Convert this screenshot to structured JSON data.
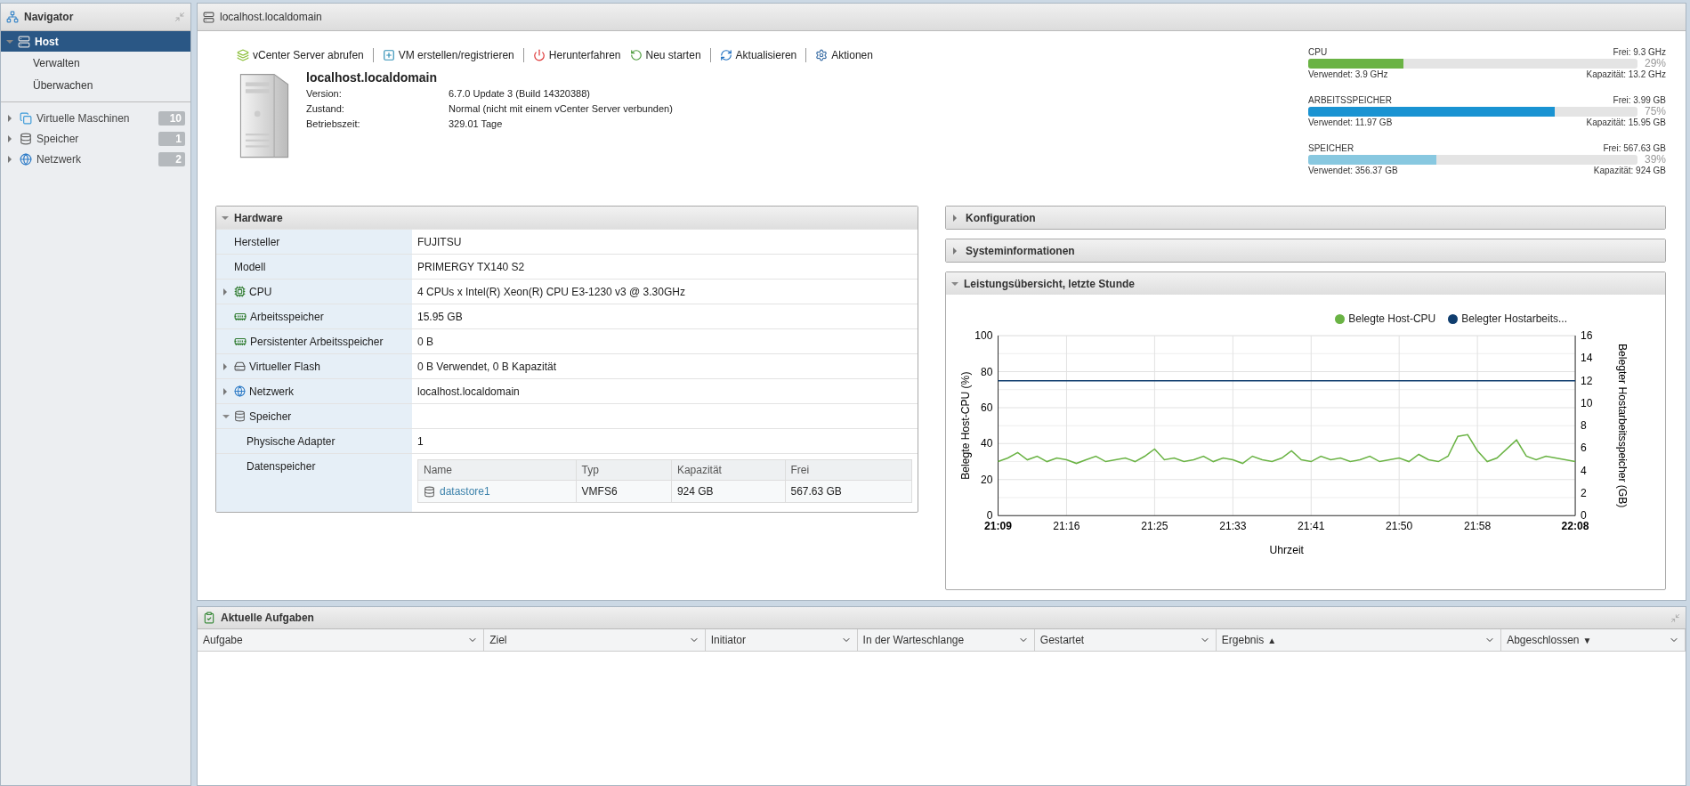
{
  "navigator": {
    "title": "Navigator",
    "items": [
      {
        "label": "Host",
        "kind": "host",
        "selected": true,
        "expanded": true,
        "children": [
          {
            "label": "Verwalten",
            "selected": false
          },
          {
            "label": "Überwachen",
            "selected": false
          }
        ]
      },
      {
        "label": "Virtuelle Maschinen",
        "kind": "vms",
        "count": "10",
        "selected": false,
        "expanded": false
      },
      {
        "label": "Speicher",
        "kind": "storage",
        "count": "1",
        "selected": false,
        "expanded": false
      },
      {
        "label": "Netzwerk",
        "kind": "network",
        "count": "2",
        "selected": false,
        "expanded": false
      }
    ]
  },
  "main": {
    "title": "localhost.localdomain",
    "toolbar": [
      {
        "label": "vCenter Server abrufen",
        "kind": "vcenter",
        "separator_before": false
      },
      {
        "label": "VM erstellen/registrieren",
        "kind": "create",
        "separator_before": true
      },
      {
        "label": "Herunterfahren",
        "kind": "shutdown",
        "separator_before": true
      },
      {
        "label": "Neu starten",
        "kind": "restart",
        "separator_before": false
      },
      {
        "label": "Aktualisieren",
        "kind": "refresh",
        "separator_before": true
      },
      {
        "label": "Aktionen",
        "kind": "actions",
        "separator_before": true
      }
    ],
    "host": {
      "name": "localhost.localdomain",
      "properties": [
        {
          "label": "Version:",
          "value": "6.7.0 Update 3 (Build 14320388)"
        },
        {
          "label": "Zustand:",
          "value": "Normal (nicht mit einem vCenter Server verbunden)"
        },
        {
          "label": "Betriebszeit:",
          "value": "329.01 Tage"
        }
      ]
    },
    "meters": [
      {
        "label": "CPU",
        "free": "Frei: 9.3 GHz",
        "percent": "29%",
        "used": "Verwendet: 3.9 GHz",
        "capacity": "Kapazität: 13.2 GHz",
        "level": 0.29,
        "color": "#6ab344"
      },
      {
        "label": "ARBEITSSPEICHER",
        "free": "Frei: 3.99 GB",
        "percent": "75%",
        "used": "Verwendet: 11.97 GB",
        "capacity": "Kapazität: 15.95 GB",
        "level": 0.75,
        "color": "#1a93d2"
      },
      {
        "label": "SPEICHER",
        "free": "Frei: 567.63 GB",
        "percent": "39%",
        "used": "Verwendet: 356.37 GB",
        "capacity": "Kapazität: 924 GB",
        "level": 0.39,
        "color": "#88c8e0"
      }
    ],
    "hardware": {
      "title": "Hardware",
      "expanded": true,
      "rows": [
        {
          "label": "Hersteller",
          "value": "FUJITSU"
        },
        {
          "label": "Modell",
          "value": "PRIMERGY TX140 S2"
        },
        {
          "label": "CPU",
          "kind": "cpu",
          "expanded": false,
          "value": "4 CPUs x Intel(R) Xeon(R) CPU E3-1230 v3 @ 3.30GHz"
        },
        {
          "label": "Arbeitsspeicher",
          "kind": "memory",
          "value": "15.95 GB"
        },
        {
          "label": "Persistenter Arbeitsspeicher",
          "kind": "memory",
          "value": "0 B"
        },
        {
          "label": "Virtueller Flash",
          "kind": "flash",
          "expanded": false,
          "value": "0 B Verwendet, 0 B Kapazität"
        },
        {
          "label": "Netzwerk",
          "kind": "network",
          "expanded": false,
          "value": "localhost.localdomain"
        },
        {
          "label": "Speicher",
          "kind": "storage",
          "expanded": true,
          "children": [
            {
              "label": "Physische Adapter",
              "value": "1"
            },
            {
              "label": "Datenspeicher",
              "table": {
                "columns": [
                  "Name",
                  "Typ",
                  "Kapazität",
                  "Frei"
                ],
                "rows": [
                  {
                    "cells": [
                      "datastore1",
                      "VMFS6",
                      "924 GB",
                      "567.63 GB"
                    ]
                  }
                ]
              }
            }
          ]
        }
      ]
    },
    "panels": [
      {
        "title": "Konfiguration",
        "expanded": false
      },
      {
        "title": "Systeminformationen",
        "expanded": false
      },
      {
        "title": "Leistungsübersicht, letzte Stunde",
        "expanded": true,
        "chart_data": {
          "type": "line",
          "xlabel": "Uhrzeit",
          "ylabel": "Belegte Host-CPU (%)",
          "y2label": "Belegter Hostarbeitsspeicher (GB)",
          "categories": [
            "21:09",
            null,
            null,
            null,
            null,
            null,
            null,
            "21:16",
            null,
            null,
            null,
            null,
            null,
            null,
            null,
            null,
            "21:25",
            null,
            null,
            null,
            null,
            null,
            null,
            null,
            "21:33",
            null,
            null,
            null,
            null,
            null,
            null,
            null,
            "21:41",
            null,
            null,
            null,
            null,
            null,
            null,
            null,
            null,
            "21:50",
            null,
            null,
            null,
            null,
            null,
            null,
            null,
            "21:58",
            null,
            null,
            null,
            null,
            null,
            null,
            null,
            null,
            null,
            "22:08"
          ],
          "grid": true,
          "ylim": [
            0,
            100
          ],
          "y2lim": [
            0,
            16
          ],
          "yticks": [
            0,
            20,
            40,
            60,
            80,
            100
          ],
          "y2ticks": [
            0,
            2,
            4,
            6,
            8,
            10,
            12,
            14,
            16
          ],
          "series": [
            {
              "name": "Belegte Host-CPU",
              "color": "#6ab344",
              "values": [
                30,
                32,
                35,
                31,
                33,
                30,
                32,
                31,
                29,
                31,
                33,
                30,
                31,
                32,
                30,
                33,
                37,
                31,
                32,
                30,
                31,
                33,
                30,
                32,
                31,
                29,
                33,
                31,
                30,
                32,
                36,
                31,
                30,
                33,
                31,
                32,
                30,
                31,
                33,
                30,
                31,
                32,
                30,
                34,
                31,
                30,
                33,
                44,
                45,
                36,
                30,
                32,
                37,
                42,
                33,
                31,
                33,
                32,
                31,
                30
              ]
            },
            {
              "name": "Belegter Hostarbeits...",
              "color": "#0f3d6e",
              "axis": "y2",
              "values": [
                12,
                12,
                12,
                12,
                12,
                12,
                12,
                12,
                12,
                12,
                12,
                12,
                12,
                12,
                12,
                12,
                12,
                12,
                12,
                12,
                12,
                12,
                12,
                12,
                12,
                12,
                12,
                12,
                12,
                12,
                12,
                12,
                12,
                12,
                12,
                12,
                12,
                12,
                12,
                12,
                12,
                12,
                12,
                12,
                12,
                12,
                12,
                12,
                12,
                12,
                12,
                12,
                12,
                12,
                12,
                12,
                12,
                12,
                12,
                12
              ]
            }
          ]
        }
      }
    ]
  },
  "tasks": {
    "title": "Aktuelle Aufgaben",
    "columns": [
      {
        "label": "Aufgabe"
      },
      {
        "label": "Ziel"
      },
      {
        "label": "Initiator"
      },
      {
        "label": "In der Warteschlange"
      },
      {
        "label": "Gestartet"
      },
      {
        "label": "Ergebnis",
        "sort_mark": "▲"
      },
      {
        "label": "Abgeschlossen",
        "sort_mark": "▼"
      }
    ]
  }
}
